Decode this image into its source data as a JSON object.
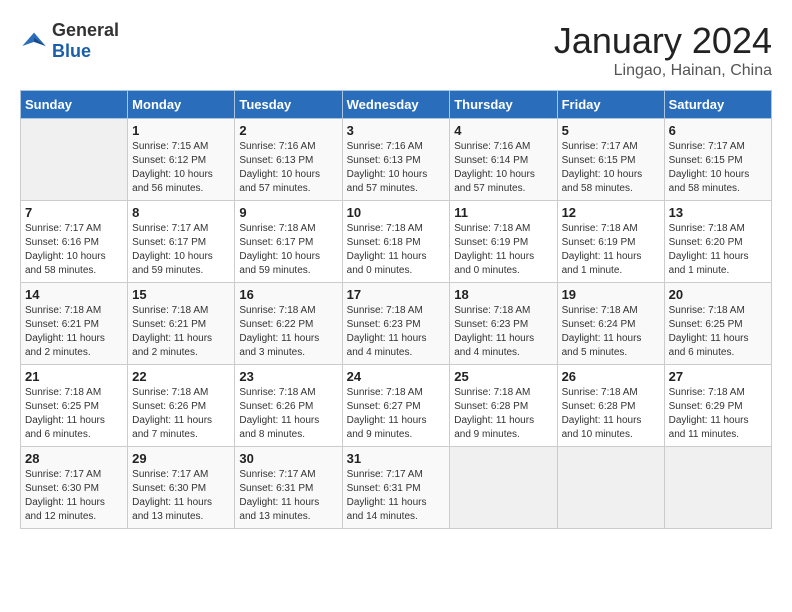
{
  "header": {
    "logo_general": "General",
    "logo_blue": "Blue",
    "title": "January 2024",
    "subtitle": "Lingao, Hainan, China"
  },
  "days_of_week": [
    "Sunday",
    "Monday",
    "Tuesday",
    "Wednesday",
    "Thursday",
    "Friday",
    "Saturday"
  ],
  "weeks": [
    [
      {
        "day": "",
        "info": ""
      },
      {
        "day": "1",
        "info": "Sunrise: 7:15 AM\nSunset: 6:12 PM\nDaylight: 10 hours\nand 56 minutes."
      },
      {
        "day": "2",
        "info": "Sunrise: 7:16 AM\nSunset: 6:13 PM\nDaylight: 10 hours\nand 57 minutes."
      },
      {
        "day": "3",
        "info": "Sunrise: 7:16 AM\nSunset: 6:13 PM\nDaylight: 10 hours\nand 57 minutes."
      },
      {
        "day": "4",
        "info": "Sunrise: 7:16 AM\nSunset: 6:14 PM\nDaylight: 10 hours\nand 57 minutes."
      },
      {
        "day": "5",
        "info": "Sunrise: 7:17 AM\nSunset: 6:15 PM\nDaylight: 10 hours\nand 58 minutes."
      },
      {
        "day": "6",
        "info": "Sunrise: 7:17 AM\nSunset: 6:15 PM\nDaylight: 10 hours\nand 58 minutes."
      }
    ],
    [
      {
        "day": "7",
        "info": "Sunrise: 7:17 AM\nSunset: 6:16 PM\nDaylight: 10 hours\nand 58 minutes."
      },
      {
        "day": "8",
        "info": "Sunrise: 7:17 AM\nSunset: 6:17 PM\nDaylight: 10 hours\nand 59 minutes."
      },
      {
        "day": "9",
        "info": "Sunrise: 7:18 AM\nSunset: 6:17 PM\nDaylight: 10 hours\nand 59 minutes."
      },
      {
        "day": "10",
        "info": "Sunrise: 7:18 AM\nSunset: 6:18 PM\nDaylight: 11 hours\nand 0 minutes."
      },
      {
        "day": "11",
        "info": "Sunrise: 7:18 AM\nSunset: 6:19 PM\nDaylight: 11 hours\nand 0 minutes."
      },
      {
        "day": "12",
        "info": "Sunrise: 7:18 AM\nSunset: 6:19 PM\nDaylight: 11 hours\nand 1 minute."
      },
      {
        "day": "13",
        "info": "Sunrise: 7:18 AM\nSunset: 6:20 PM\nDaylight: 11 hours\nand 1 minute."
      }
    ],
    [
      {
        "day": "14",
        "info": "Sunrise: 7:18 AM\nSunset: 6:21 PM\nDaylight: 11 hours\nand 2 minutes."
      },
      {
        "day": "15",
        "info": "Sunrise: 7:18 AM\nSunset: 6:21 PM\nDaylight: 11 hours\nand 2 minutes."
      },
      {
        "day": "16",
        "info": "Sunrise: 7:18 AM\nSunset: 6:22 PM\nDaylight: 11 hours\nand 3 minutes."
      },
      {
        "day": "17",
        "info": "Sunrise: 7:18 AM\nSunset: 6:23 PM\nDaylight: 11 hours\nand 4 minutes."
      },
      {
        "day": "18",
        "info": "Sunrise: 7:18 AM\nSunset: 6:23 PM\nDaylight: 11 hours\nand 4 minutes."
      },
      {
        "day": "19",
        "info": "Sunrise: 7:18 AM\nSunset: 6:24 PM\nDaylight: 11 hours\nand 5 minutes."
      },
      {
        "day": "20",
        "info": "Sunrise: 7:18 AM\nSunset: 6:25 PM\nDaylight: 11 hours\nand 6 minutes."
      }
    ],
    [
      {
        "day": "21",
        "info": "Sunrise: 7:18 AM\nSunset: 6:25 PM\nDaylight: 11 hours\nand 6 minutes."
      },
      {
        "day": "22",
        "info": "Sunrise: 7:18 AM\nSunset: 6:26 PM\nDaylight: 11 hours\nand 7 minutes."
      },
      {
        "day": "23",
        "info": "Sunrise: 7:18 AM\nSunset: 6:26 PM\nDaylight: 11 hours\nand 8 minutes."
      },
      {
        "day": "24",
        "info": "Sunrise: 7:18 AM\nSunset: 6:27 PM\nDaylight: 11 hours\nand 9 minutes."
      },
      {
        "day": "25",
        "info": "Sunrise: 7:18 AM\nSunset: 6:28 PM\nDaylight: 11 hours\nand 9 minutes."
      },
      {
        "day": "26",
        "info": "Sunrise: 7:18 AM\nSunset: 6:28 PM\nDaylight: 11 hours\nand 10 minutes."
      },
      {
        "day": "27",
        "info": "Sunrise: 7:18 AM\nSunset: 6:29 PM\nDaylight: 11 hours\nand 11 minutes."
      }
    ],
    [
      {
        "day": "28",
        "info": "Sunrise: 7:17 AM\nSunset: 6:30 PM\nDaylight: 11 hours\nand 12 minutes."
      },
      {
        "day": "29",
        "info": "Sunrise: 7:17 AM\nSunset: 6:30 PM\nDaylight: 11 hours\nand 13 minutes."
      },
      {
        "day": "30",
        "info": "Sunrise: 7:17 AM\nSunset: 6:31 PM\nDaylight: 11 hours\nand 13 minutes."
      },
      {
        "day": "31",
        "info": "Sunrise: 7:17 AM\nSunset: 6:31 PM\nDaylight: 11 hours\nand 14 minutes."
      },
      {
        "day": "",
        "info": ""
      },
      {
        "day": "",
        "info": ""
      },
      {
        "day": "",
        "info": ""
      }
    ]
  ]
}
